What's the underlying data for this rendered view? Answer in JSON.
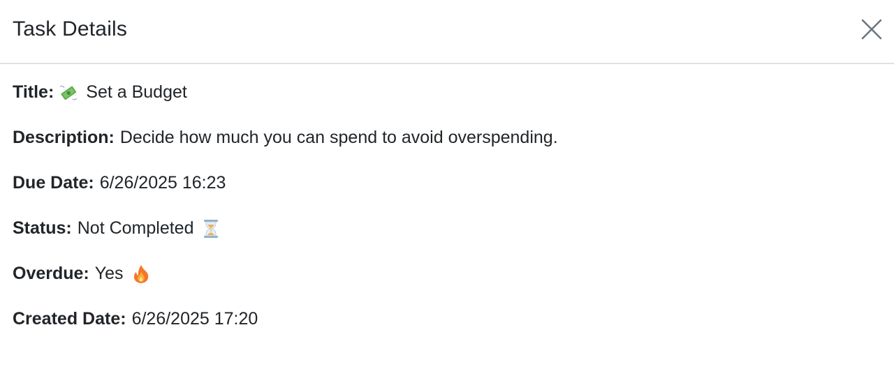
{
  "dialog": {
    "title": "Task Details",
    "close_icon": "close-icon"
  },
  "fields": {
    "title": {
      "label": "Title:",
      "value": "Set a Budget",
      "emoji": "money-with-wings-icon"
    },
    "description": {
      "label": "Description:",
      "value": "Decide how much you can spend to avoid overspending."
    },
    "due_date": {
      "label": "Due Date:",
      "value": "6/26/2025 16:23"
    },
    "status": {
      "label": "Status:",
      "value": "Not Completed",
      "emoji": "hourglass-icon"
    },
    "overdue": {
      "label": "Overdue:",
      "value": "Yes",
      "emoji": "fire-icon"
    },
    "created_date": {
      "label": "Created Date:",
      "value": "6/26/2025 17:20"
    }
  },
  "colors": {
    "text": "#212529",
    "divider": "#dee2e6",
    "close_icon": "#6c757d"
  }
}
